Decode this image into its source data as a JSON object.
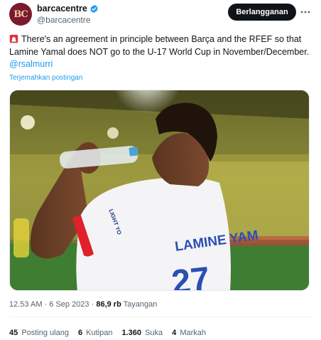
{
  "account": {
    "avatar_text": "BC",
    "display_name": "barcacentre",
    "handle": "@barcacentre",
    "verified_color": "#1d9bf0"
  },
  "actions": {
    "subscribe_label": "Berlangganan",
    "more_icon": "more-horizontal-icon"
  },
  "tweet": {
    "text": "There's an agreement in principle between Barça and the RFEF so that Lamine Yamal does NOT go to the U-17 World Cup in November/December.",
    "mention": "@rsalmurri",
    "translate_label": "Terjemahkan postingan",
    "leading_icon": "siren-icon"
  },
  "media": {
    "jersey_text": "LAMINE YAM",
    "jersey_number": "27",
    "sponsor_text": "LIGHT YO",
    "description_icon": "photo"
  },
  "meta": {
    "time": "12.53 AM",
    "date": "6 Sep 2023",
    "views": "86,9 rb",
    "views_label": "Tayangan"
  },
  "stats": {
    "reposts": "45",
    "reposts_label": "Posting ulang",
    "quotes": "6",
    "quotes_label": "Kutipan",
    "likes": "1.360",
    "likes_label": "Suka",
    "bookmarks": "4",
    "bookmarks_label": "Markah"
  },
  "colors": {
    "accent": "#1d9bf0",
    "text_primary": "#0f1419",
    "text_secondary": "#536471"
  }
}
